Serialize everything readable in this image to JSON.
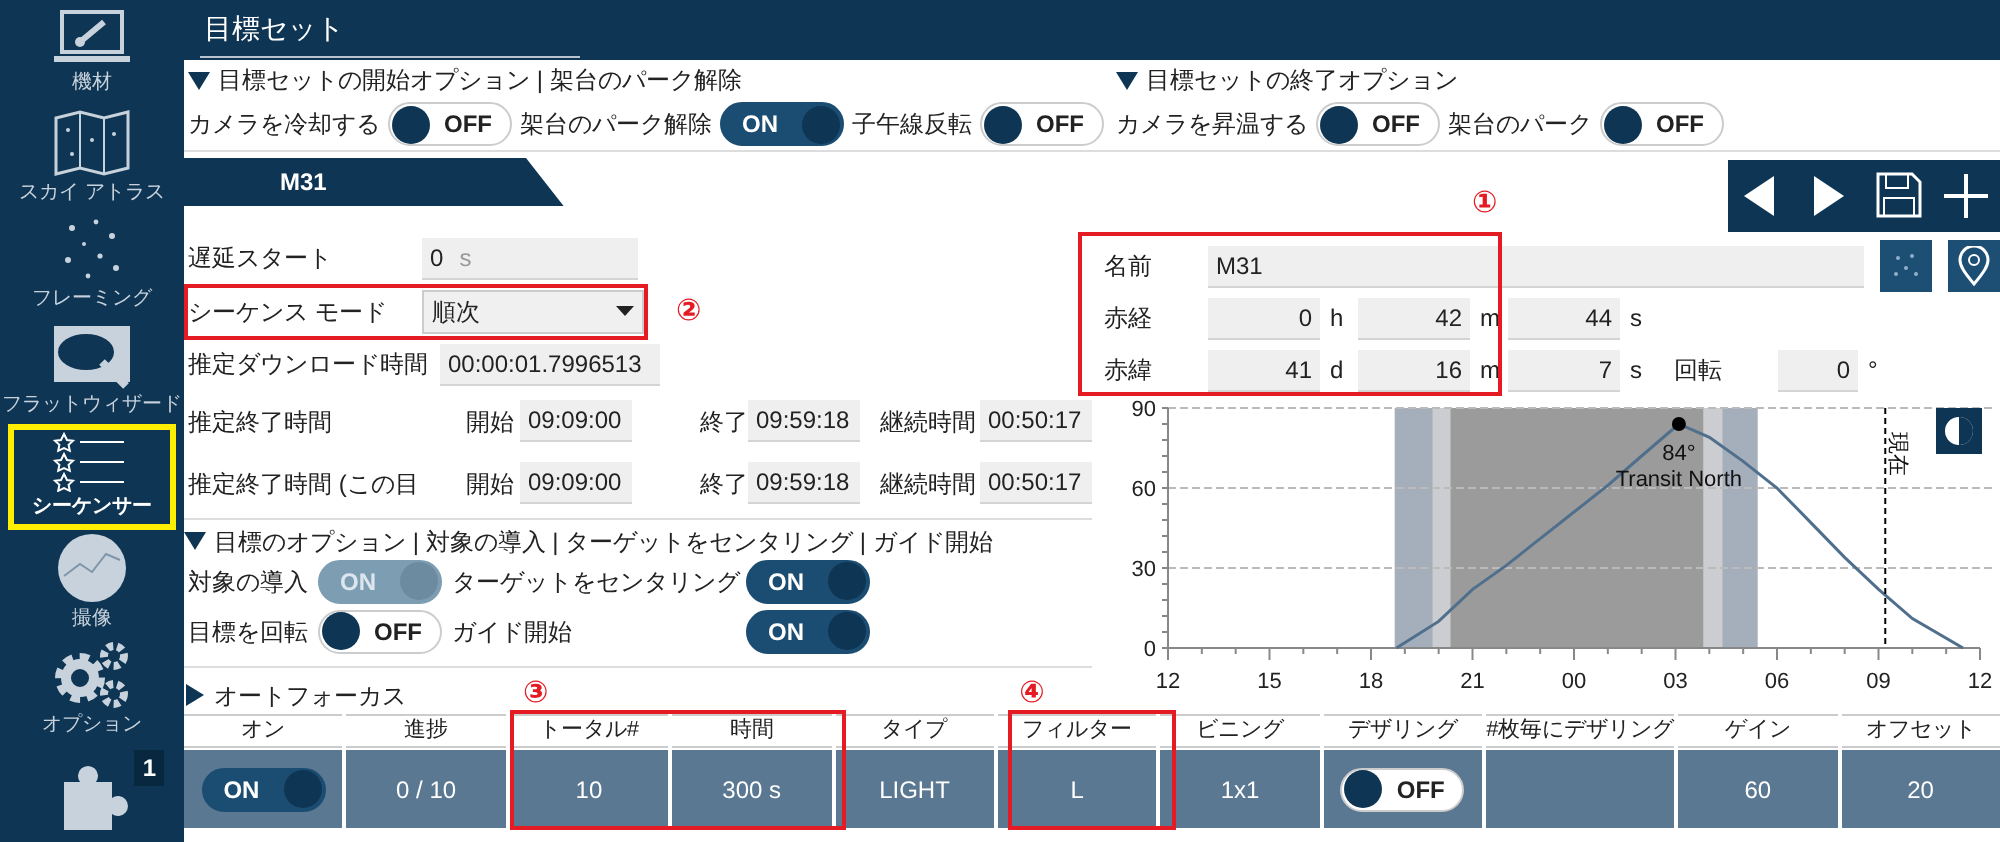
{
  "sidebar": {
    "items": [
      {
        "label": "機材",
        "selected": false,
        "highlighted": false
      },
      {
        "label": "スカイ アトラス",
        "selected": false,
        "highlighted": false
      },
      {
        "label": "フレーミング",
        "selected": false,
        "highlighted": false
      },
      {
        "label": "フラットウィザード",
        "selected": false,
        "highlighted": false
      },
      {
        "label": "シーケンサー",
        "selected": true,
        "highlighted": true
      },
      {
        "label": "撮像",
        "selected": false,
        "highlighted": false
      },
      {
        "label": "オプション",
        "selected": false,
        "highlighted": false
      },
      {
        "badge": "1",
        "selected": false,
        "highlighted": false
      }
    ]
  },
  "header": {
    "title": "目標セット"
  },
  "start_options": {
    "title": "目標セットの開始オプション | 架台のパーク解除",
    "expanded": true,
    "toggles": [
      {
        "label": "カメラを冷却する",
        "on": false,
        "text": "OFF"
      },
      {
        "label": "架台のパーク解除",
        "on": true,
        "text": "ON"
      },
      {
        "label": "子午線反転",
        "on": false,
        "text": "OFF"
      }
    ]
  },
  "end_options": {
    "title": "目標セットの終了オプション",
    "expanded": true,
    "toggles": [
      {
        "label": "カメラを昇温する",
        "on": false,
        "text": "OFF"
      },
      {
        "label": "架台のパーク",
        "on": false,
        "text": "OFF"
      }
    ]
  },
  "target_tab": {
    "label": "M31"
  },
  "form": {
    "delay": {
      "label": "遅延スタート",
      "value": "0",
      "unit": "s"
    },
    "mode": {
      "label": "シーケンス モード",
      "value": "順次",
      "annotation": "②"
    },
    "download": {
      "label": "推定ダウンロード時間",
      "value": "00:00:01.7996513"
    },
    "end_rows": [
      {
        "label": "推定終了時間",
        "start_label": "開始",
        "start": "09:09:00",
        "end_label": "終了",
        "end": "09:59:18",
        "duration_label": "継続時間",
        "duration": "00:50:17"
      },
      {
        "label": "推定終了時間 (この目",
        "start_label": "開始",
        "start": "09:09:00",
        "end_label": "終了",
        "end": "09:59:18",
        "duration_label": "継続時間",
        "duration": "00:50:17"
      }
    ]
  },
  "coordinates": {
    "annotation": "①",
    "name_label": "名前",
    "name": "M31",
    "ra_label": "赤経",
    "ra": [
      {
        "value": "0",
        "unit": "h"
      },
      {
        "value": "42",
        "unit": "m"
      },
      {
        "value": "44",
        "unit": "s"
      }
    ],
    "dec_label": "赤緯",
    "dec": [
      {
        "value": "41",
        "unit": "d"
      },
      {
        "value": "16",
        "unit": "m"
      },
      {
        "value": "7",
        "unit": "s"
      }
    ],
    "rotation_label": "回転",
    "rotation": "0",
    "rotation_unit": "°"
  },
  "altitude_chart": {
    "chart_data": {
      "type": "line",
      "x": [
        18.75,
        20,
        21,
        22,
        23,
        24,
        25,
        26,
        27.1,
        28,
        29,
        30,
        31,
        32,
        33,
        34,
        35.5
      ],
      "series": [
        {
          "color": "#4f6f8c",
          "values": [
            0,
            10,
            22,
            31,
            41,
            51,
            61,
            72,
            84,
            79,
            70,
            60,
            47,
            34,
            22,
            11,
            0
          ]
        }
      ],
      "xlim": [
        12,
        36
      ],
      "ylim": [
        0,
        90
      ],
      "xticks": [
        {
          "value": 12,
          "label": "12"
        },
        {
          "value": 15,
          "label": "15"
        },
        {
          "value": 18,
          "label": "18"
        },
        {
          "value": 21,
          "label": "21"
        },
        {
          "value": 24,
          "label": "00"
        },
        {
          "value": 27,
          "label": "03"
        },
        {
          "value": 30,
          "label": "06"
        },
        {
          "value": 33,
          "label": "09"
        },
        {
          "value": 36,
          "label": "12"
        }
      ],
      "yticks": [
        0,
        30,
        60,
        90
      ],
      "ref_lines": [
        {
          "axis": "x",
          "value": 33.2,
          "label": "現在"
        }
      ],
      "annotations": [
        {
          "x": 27.1,
          "y": 84,
          "text": "84°"
        },
        {
          "x": 27.1,
          "y": 84,
          "text": "Transit North"
        }
      ]
    }
  },
  "target_options": {
    "title": "目標のオプション | 対象の導入 | ターゲットをセンタリング | ガイド開始",
    "expanded": true,
    "toggles": [
      {
        "label": "対象の導入",
        "on": true,
        "text": "ON",
        "disabled": true
      },
      {
        "label": "ターゲットをセンタリング",
        "on": true,
        "text": "ON",
        "disabled": false
      },
      {
        "label": "目標を回転",
        "on": false,
        "text": "OFF",
        "disabled": false
      },
      {
        "label": "ガイド開始",
        "on": true,
        "text": "ON",
        "disabled": false
      }
    ]
  },
  "autofocus": {
    "title": "オートフォーカス",
    "expanded": false
  },
  "table": {
    "columns": [
      {
        "label": "オン",
        "annotated": false
      },
      {
        "label": "進捗",
        "annotated": false
      },
      {
        "label": "トータル#",
        "annotated": true,
        "annotation": "③"
      },
      {
        "label": "時間",
        "annotated": true
      },
      {
        "label": "タイプ",
        "annotated": false
      },
      {
        "label": "フィルター",
        "annotated": true,
        "annotation": "④"
      },
      {
        "label": "ビニング",
        "annotated": false
      },
      {
        "label": "デザリング",
        "annotated": false
      },
      {
        "label": "#枚毎にデザリング",
        "annotated": false
      },
      {
        "label": "ゲイン",
        "annotated": false
      },
      {
        "label": "オフセット",
        "annotated": false
      }
    ],
    "rows": [
      {
        "cells": [
          {
            "kind": "toggle",
            "on": true,
            "text": "ON"
          },
          {
            "kind": "text",
            "text": "0 / 10"
          },
          {
            "kind": "text",
            "text": "10"
          },
          {
            "kind": "text",
            "text": "300 s"
          },
          {
            "kind": "text",
            "text": "LIGHT"
          },
          {
            "kind": "text",
            "text": "L"
          },
          {
            "kind": "text",
            "text": "1x1"
          },
          {
            "kind": "toggle",
            "on": false,
            "text": "OFF"
          },
          {
            "kind": "empty"
          },
          {
            "kind": "text",
            "text": "60"
          },
          {
            "kind": "text",
            "text": "20"
          }
        ]
      }
    ]
  }
}
